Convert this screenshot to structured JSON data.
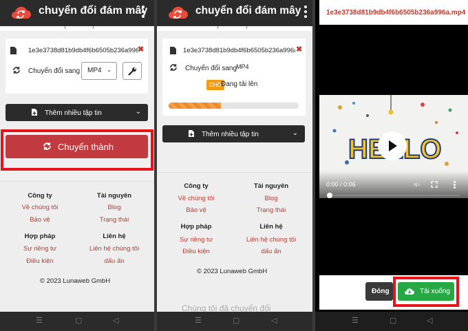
{
  "app": {
    "brand": "chuyển đổi đám mây"
  },
  "file": {
    "name": "1e3e3738d81b9db4f6b6505b236a996a.mp4"
  },
  "converter": {
    "convert_to_label": "Chuyển đổi sang",
    "format": "MP4",
    "add_files_label": "Thêm nhiều tập tin",
    "convert_button": "Chuyển thành"
  },
  "progress": {
    "status_badge": "CHỜ",
    "status_text": "Đang tải lên",
    "fraction": 0.4
  },
  "footer": {
    "company": {
      "heading": "Công ty",
      "links": [
        "Về chúng tôi",
        "Bảo vệ"
      ]
    },
    "resources": {
      "heading": "Tài nguyên",
      "links": [
        "Blog",
        "Trạng thái"
      ]
    },
    "legal": {
      "heading": "Hợp pháp",
      "links": [
        "Sự riêng tư",
        "Điều kiện"
      ]
    },
    "contact": {
      "heading": "Liên hệ",
      "links": [
        "Liên hệ chúng tôi",
        "dấu ấn"
      ]
    },
    "copyright": "© 2023 Lunaweb GmbH"
  },
  "faded_text": "Chúng tôi đã chuyển đổi",
  "player": {
    "time": "0:00 / 0:06",
    "artwork_text": "HELLO"
  },
  "dialog": {
    "close_label": "Đóng",
    "download_label": "Tải xuống"
  },
  "colors": {
    "accent_red": "#c03a3f",
    "highlight": "#e8121b",
    "download_green": "#27a844",
    "progress_orange": "#f08a24",
    "dark_bar": "#2b2b2b"
  }
}
